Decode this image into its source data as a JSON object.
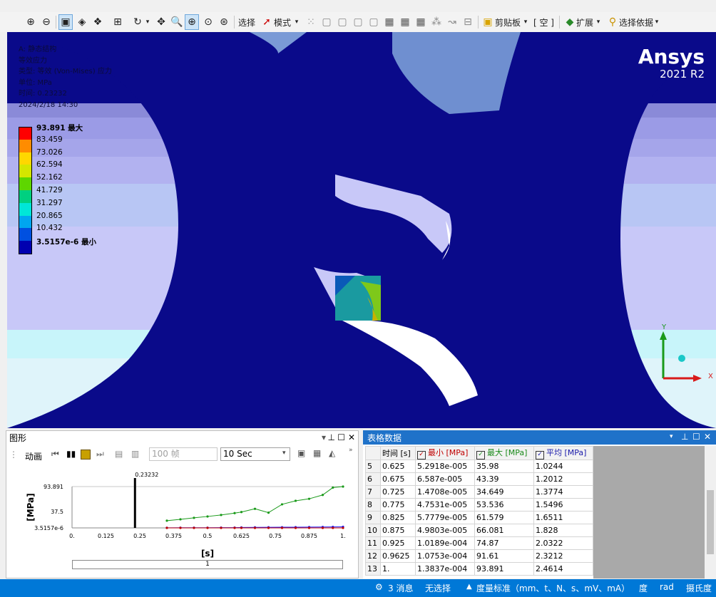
{
  "toolbar": {
    "select_label": "选择",
    "mode_label": "模式",
    "clipboard_label": "剪贴板",
    "empty_label": "[ 空 ]",
    "extend_label": "扩展",
    "select_by_label": "选择依据"
  },
  "viewport": {
    "info": [
      "A: 静态结构",
      "等效应力",
      "类型: 等效 (Von-Mises) 应力",
      "单位: MPa",
      "时间: 0.23232",
      "2024/2/18 14:30"
    ],
    "brand": "Ansys",
    "version": "2021 R2",
    "legend": [
      {
        "label": "93.891 最大",
        "color": "#ff0000",
        "bold": true
      },
      {
        "label": "83.459",
        "color": "#ff8c00",
        "bold": false
      },
      {
        "label": "73.026",
        "color": "#ffd700",
        "bold": false
      },
      {
        "label": "62.594",
        "color": "#d4e600",
        "bold": false
      },
      {
        "label": "52.162",
        "color": "#5ed600",
        "bold": false
      },
      {
        "label": "41.729",
        "color": "#00d080",
        "bold": false
      },
      {
        "label": "31.297",
        "color": "#00e6d8",
        "bold": false
      },
      {
        "label": "20.865",
        "color": "#00a6f0",
        "bold": false
      },
      {
        "label": "10.432",
        "color": "#0050e0",
        "bold": false
      },
      {
        "label": "3.5157e-6 最小",
        "color": "#0000b0",
        "bold": true
      }
    ],
    "axis_y": "Y",
    "axis_x": "X"
  },
  "graph_panel": {
    "title": "图形",
    "animation_label": "动画",
    "frames_value": "100 帧",
    "duration_value": "10 Sec",
    "slider_value": "1"
  },
  "chart_data": {
    "type": "line",
    "ylabel": "[MPa]",
    "xlabel": "[s]",
    "current_time": 0.23232,
    "current_time_label": "0.23232",
    "xlim": [
      0,
      1
    ],
    "ylim": [
      3.5157e-06,
      93.891
    ],
    "y_ticks": [
      "93.891",
      "37.5",
      "3.5157e-6"
    ],
    "x_ticks": [
      "0.",
      "0.125",
      "0.25",
      "0.375",
      "0.5",
      "0.625",
      "0.75",
      "0.875",
      "1."
    ],
    "x": [
      0.35,
      0.4,
      0.45,
      0.5,
      0.55,
      0.6,
      0.625,
      0.675,
      0.725,
      0.775,
      0.825,
      0.875,
      0.925,
      0.9625,
      1.0
    ],
    "series": [
      {
        "color": "#1a9a1a",
        "values": [
          16.4,
          19.5,
          22.9,
          26.0,
          29.3,
          33.6,
          35.98,
          43.39,
          34.649,
          53.536,
          61.579,
          66.081,
          74.87,
          91.61,
          93.891
        ]
      },
      {
        "color": "#1a1aff",
        "values": [
          0.3,
          0.35,
          0.4,
          0.5,
          0.55,
          0.6,
          1.0244,
          1.2012,
          1.3774,
          1.5496,
          1.6511,
          1.828,
          2.0322,
          2.3212,
          2.4614
        ]
      },
      {
        "color": "#c00000",
        "values": [
          1e-05,
          1e-05,
          1e-05,
          1e-05,
          1e-05,
          1e-05,
          5.2918e-05,
          6.587e-05,
          0.00014708,
          4.7531e-05,
          5.7779e-05,
          4.9803e-05,
          0.00010189,
          0.00010753,
          0.00013837
        ]
      }
    ]
  },
  "table_panel": {
    "title": "表格数据",
    "headers": [
      "时间 [s]",
      "最小 [MPa]",
      "最大 [MPa]",
      "平均 [MPa]"
    ],
    "rows": [
      [
        "5",
        "0.625",
        "5.2918e-005",
        "35.98",
        "1.0244"
      ],
      [
        "6",
        "0.675",
        "6.587e-005",
        "43.39",
        "1.2012"
      ],
      [
        "7",
        "0.725",
        "1.4708e-005",
        "34.649",
        "1.3774"
      ],
      [
        "8",
        "0.775",
        "4.7531e-005",
        "53.536",
        "1.5496"
      ],
      [
        "9",
        "0.825",
        "5.7779e-005",
        "61.579",
        "1.6511"
      ],
      [
        "10",
        "0.875",
        "4.9803e-005",
        "66.081",
        "1.828"
      ],
      [
        "11",
        "0.925",
        "1.0189e-004",
        "74.87",
        "2.0322"
      ],
      [
        "12",
        "0.9625",
        "1.0753e-004",
        "91.61",
        "2.3212"
      ],
      [
        "13",
        "1.",
        "1.3837e-004",
        "93.891",
        "2.4614"
      ]
    ]
  },
  "statusbar": {
    "messages": "3 消息",
    "selection": "无选择",
    "units": "度量标准（mm、t、N、s、mV、mA）",
    "angle": "度",
    "rad": "rad",
    "temp": "摄氏度"
  }
}
